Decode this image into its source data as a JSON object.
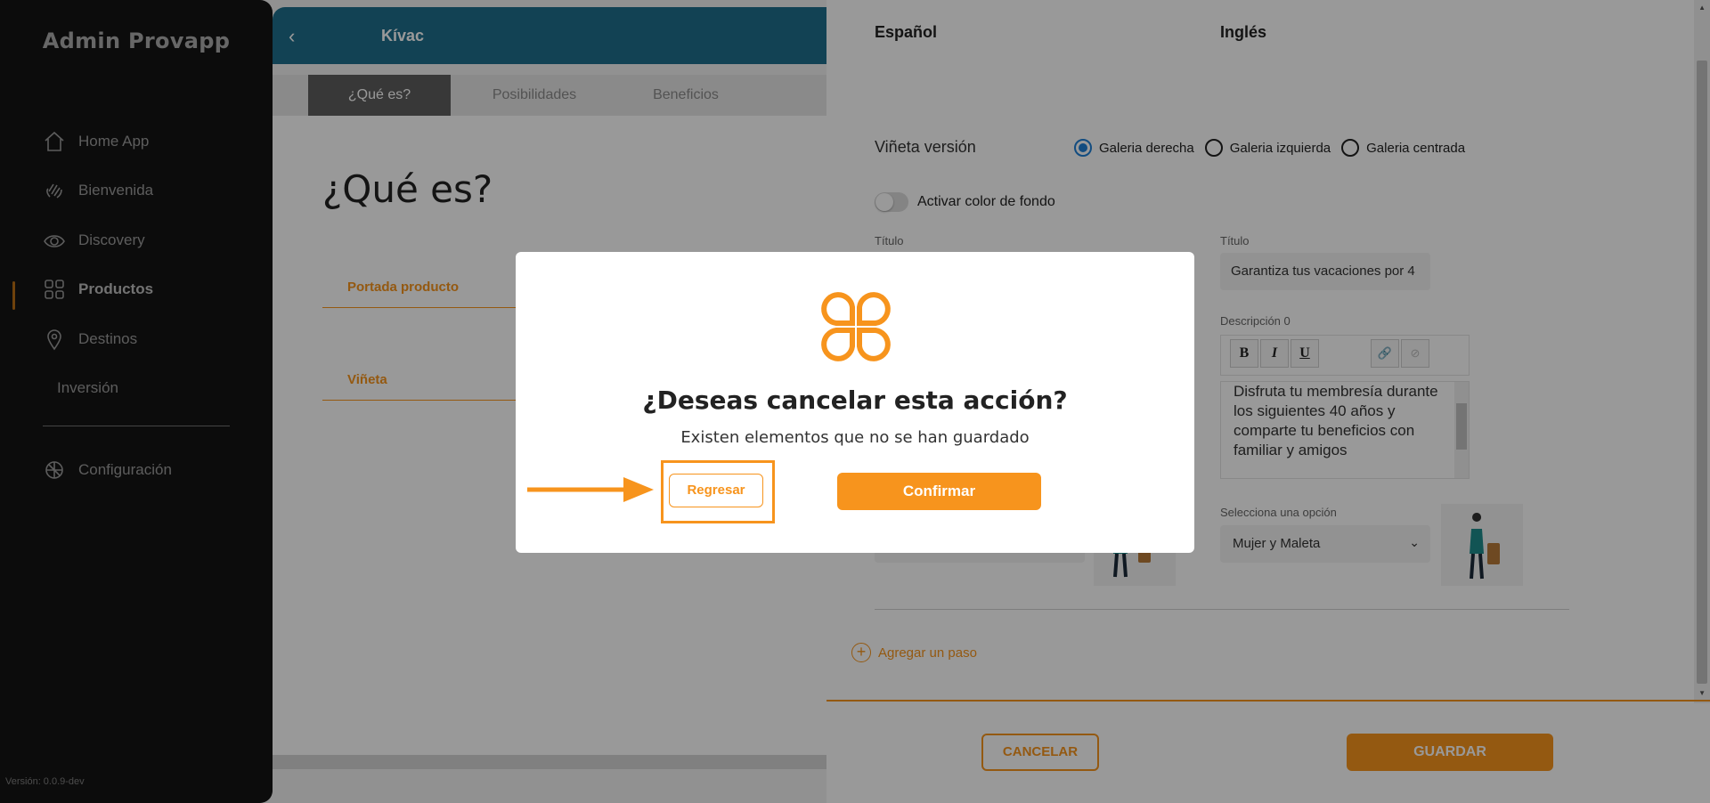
{
  "sidebar": {
    "brand": "Admin Provapp",
    "items": [
      {
        "label": "Home App",
        "icon": "home-icon"
      },
      {
        "label": "Bienvenida",
        "icon": "wave-hand-icon"
      },
      {
        "label": "Discovery",
        "icon": "eye-icon"
      },
      {
        "label": "Productos",
        "icon": "grid-icon",
        "active": true
      },
      {
        "label": "Destinos",
        "icon": "location-pin-icon"
      },
      {
        "label": "Inversión",
        "icon": ""
      },
      {
        "label": "Configuración",
        "icon": "gear-icon"
      }
    ],
    "version": "Versión: 0.0.9-dev"
  },
  "header": {
    "title": "Kívac"
  },
  "tabs": [
    {
      "label": "¿Qué es?",
      "active": true
    },
    {
      "label": "Posibilidades"
    },
    {
      "label": "Beneficios"
    }
  ],
  "main": {
    "heading": "¿Qué es?",
    "sections": [
      "Portada producto",
      "Viñeta"
    ]
  },
  "panel": {
    "lang_es": "Español",
    "lang_en": "Inglés",
    "vineta_label": "Viñeta versión",
    "radios": [
      {
        "label": "Galeria derecha",
        "checked": true
      },
      {
        "label": "Galeria izquierda",
        "checked": false
      },
      {
        "label": "Galeria centrada",
        "checked": false
      }
    ],
    "toggle_label": "Activar color de fondo",
    "titulo_left": "Título",
    "titulo_right": "Título",
    "titulo_value": "Garantiza tus vacaciones por 4",
    "descripcion_label": "Descripción 0",
    "toolbar": {
      "bold": "B",
      "italic": "I",
      "underline": "U"
    },
    "descripcion_text": "Disfruta tu membresía durante los siguientes 40 años y comparte tu beneficios con familiar y amigos",
    "select_label": "Selecciona una opción",
    "select_value": "Mujer y Maleta",
    "add_step": "Agregar un paso",
    "cancel": "CANCELAR",
    "save": "GUARDAR"
  },
  "modal": {
    "title": "¿Deseas cancelar esta acción?",
    "subtitle": "Existen elementos que no se han guardado",
    "back": "Regresar",
    "confirm": "Confirmar"
  },
  "colors": {
    "accent": "#f7941d",
    "topbar": "#1e6f8c",
    "sidebar": "#1b1b1b"
  }
}
